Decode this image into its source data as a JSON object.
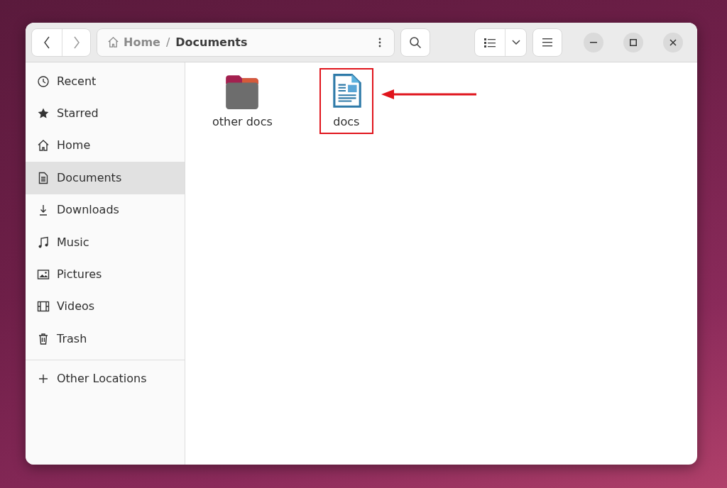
{
  "toolbar": {
    "path": [
      {
        "label": "Home",
        "kind": "home",
        "current": false
      },
      {
        "label": "/",
        "kind": "separator"
      },
      {
        "label": "Documents",
        "kind": "folder",
        "current": true
      }
    ]
  },
  "sidebar": {
    "items": [
      {
        "label": "Recent",
        "kind": "recent",
        "selected": false
      },
      {
        "label": "Starred",
        "kind": "starred",
        "selected": false
      },
      {
        "label": "Home",
        "kind": "home",
        "selected": false
      },
      {
        "label": "Documents",
        "kind": "documents",
        "selected": true
      },
      {
        "label": "Downloads",
        "kind": "downloads",
        "selected": false
      },
      {
        "label": "Music",
        "kind": "music",
        "selected": false
      },
      {
        "label": "Pictures",
        "kind": "pictures",
        "selected": false
      },
      {
        "label": "Videos",
        "kind": "videos",
        "selected": false
      },
      {
        "label": "Trash",
        "kind": "trash",
        "selected": false
      }
    ],
    "other_locations": {
      "label": "Other Locations"
    }
  },
  "files": [
    {
      "name": "other docs",
      "kind": "folder",
      "highlighted": false
    },
    {
      "name": "docs",
      "kind": "document",
      "highlighted": true
    }
  ]
}
